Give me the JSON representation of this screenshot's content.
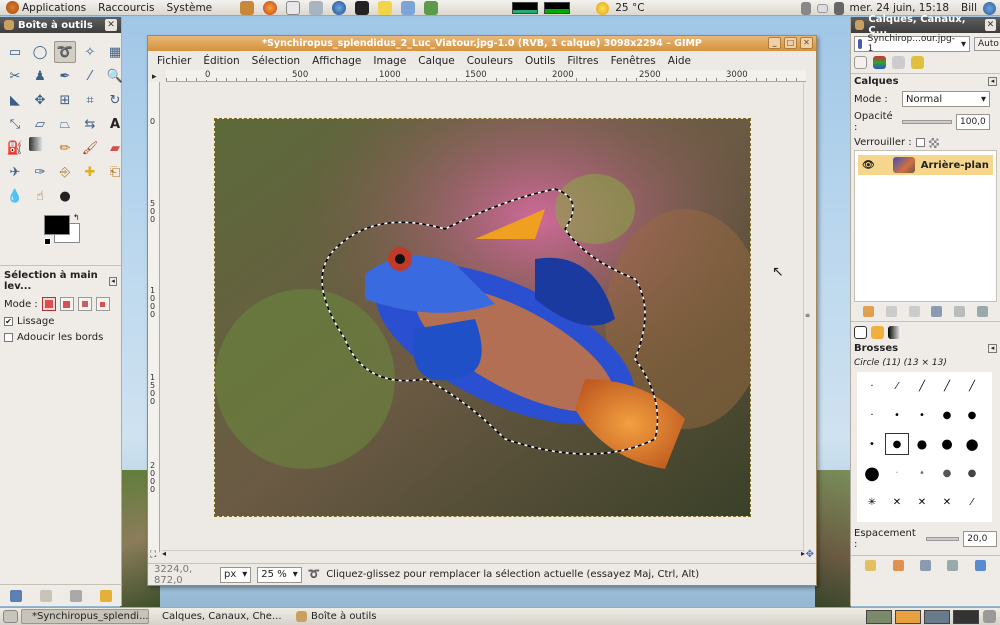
{
  "top_panel": {
    "menus": [
      "Applications",
      "Raccourcis",
      "Système"
    ],
    "weather": "25 °C",
    "clock": "mer. 24 juin, 15:18",
    "user": "Bill"
  },
  "toolbox": {
    "title": "Boîte à outils",
    "tool_options_title": "Sélection à main lev...",
    "mode_label": "Mode :",
    "option_smoothing": "Lissage",
    "option_smoothing_checked": true,
    "option_feather": "Adoucir les bords",
    "option_feather_checked": false
  },
  "image_window": {
    "title": "*Synchiropus_splendidus_2_Luc_Viatour.jpg-1.0 (RVB, 1 calque) 3098x2294 – GIMP",
    "menus": [
      "Fichier",
      "Édition",
      "Sélection",
      "Affichage",
      "Image",
      "Calque",
      "Couleurs",
      "Outils",
      "Filtres",
      "Fenêtres",
      "Aide"
    ],
    "ruler_h_labels": [
      "0",
      "500",
      "1000",
      "1500",
      "2000",
      "2500",
      "3000"
    ],
    "ruler_v_labels": [
      "0",
      "500",
      "1000",
      "1500",
      "2000"
    ],
    "coords": "3224,0, 872,0",
    "unit": "px",
    "zoom": "25 %",
    "status_message": "Cliquez-glissez pour remplacer la sélection actuelle (essayez Maj, Ctrl, Alt)"
  },
  "right_dock": {
    "title": "Calques, Canaux, C...",
    "image_select": "Synchirop...our.jpg-1",
    "auto_button": "Auto",
    "layers_label": "Calques",
    "mode_label": "Mode :",
    "mode_value": "Normal",
    "opacity_label": "Opacité :",
    "opacity_value": "100,0",
    "lock_label": "Verrouiller :",
    "layer_name": "Arrière-plan",
    "brushes_label": "Brosses",
    "brush_name": "Circle (11) (13 × 13)",
    "spacing_label": "Espacement :",
    "spacing_value": "20,0"
  },
  "taskbar": {
    "tasks": [
      "*Synchiropus_splendi...",
      "Calques, Canaux, Che...",
      "Boîte à outils"
    ]
  }
}
